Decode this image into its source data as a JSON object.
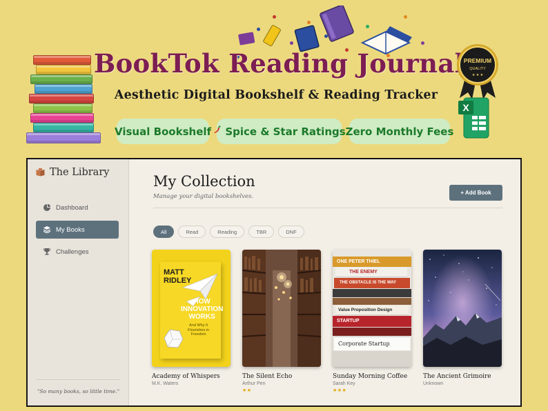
{
  "banner": {
    "title": "BookTok Reading Journal",
    "subtitle": "Aesthetic Digital Bookshelf & Reading Tracker",
    "features": [
      {
        "label": "Visual Bookshelf",
        "icon": "none"
      },
      {
        "label": "Spice & Star Ratings",
        "icon": "chili-pepper-icon"
      },
      {
        "label": "Zero Monthly Fees",
        "icon": "none"
      }
    ],
    "badge": {
      "top": "PREMIUM",
      "bottom": "QUALITY"
    },
    "colors": {
      "title": "#7c1d53",
      "pill_bg": "#cfecc4",
      "pill_text": "#1c7a2a",
      "background": "#ecd97e"
    }
  },
  "sidebar": {
    "brand": "The Library",
    "items": [
      {
        "label": "Dashboard",
        "icon": "pie-chart-icon",
        "active": false
      },
      {
        "label": "My Books",
        "icon": "layers-icon",
        "active": true
      },
      {
        "label": "Challenges",
        "icon": "trophy-icon",
        "active": false
      }
    ],
    "quote": "\"So many books, so little time.\""
  },
  "main": {
    "title": "My Collection",
    "subtitle": "Manage your digital bookshelves.",
    "add_button": "+ Add Book",
    "filters": [
      {
        "label": "All",
        "active": true
      },
      {
        "label": "Read",
        "active": false
      },
      {
        "label": "Reading",
        "active": false
      },
      {
        "label": "TBR",
        "active": false
      },
      {
        "label": "DNF",
        "active": false
      }
    ],
    "books": [
      {
        "title": "Academy of Whispers",
        "author": "M.K. Waters",
        "stars": "",
        "rating": 0,
        "cover": {
          "author_line1": "MATT",
          "author_line2": "RIDLEY",
          "title_lines": [
            "HOW",
            "INNOVATION",
            "WORKS"
          ],
          "tagline": [
            "And Why It",
            "Flourishes in",
            "Freedom"
          ]
        }
      },
      {
        "title": "The Silent Echo",
        "author": "Arthur Pen",
        "stars": "★★",
        "rating": 2
      },
      {
        "title": "Sunday Morning Coffee",
        "author": "Sarah Key",
        "stars": "★★★",
        "rating": 3,
        "cover": {
          "spines": [
            "ONE PETER THIEL",
            "THE ENEMY",
            "THE OBSTACLE IS THE WAY",
            "",
            "Value Proposition Design",
            "STARTUP",
            "Corporate Startup"
          ]
        }
      },
      {
        "title": "The Ancient Grimoire",
        "author": "Unknown",
        "stars": "",
        "rating": 0
      }
    ]
  },
  "accent_color": "#5d717d"
}
